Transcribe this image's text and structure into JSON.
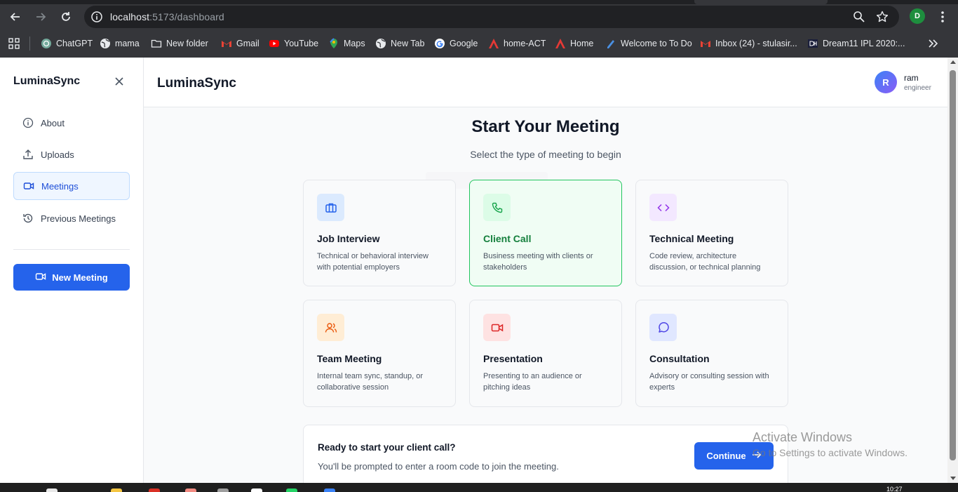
{
  "browser": {
    "url_host": "localhost",
    "url_path": ":5173/dashboard",
    "profile_initial": "D",
    "icons": [
      "back-icon",
      "forward-icon",
      "reload-icon",
      "info-icon",
      "zoom-icon",
      "star-icon",
      "kebab-menu-icon"
    ]
  },
  "bookmarks": [
    {
      "label": "ChatGPT",
      "icon": "chatgpt-icon"
    },
    {
      "label": "mama",
      "icon": "globe-icon"
    },
    {
      "label": "New folder",
      "icon": "folder-icon"
    },
    {
      "label": "Gmail",
      "icon": "gmail-icon"
    },
    {
      "label": "YouTube",
      "icon": "youtube-icon"
    },
    {
      "label": "Maps",
      "icon": "maps-icon"
    },
    {
      "label": "New Tab",
      "icon": "globe-icon"
    },
    {
      "label": "Google",
      "icon": "google-icon"
    },
    {
      "label": "home-ACT",
      "icon": "act-icon"
    },
    {
      "label": "Home",
      "icon": "act-icon"
    },
    {
      "label": "Welcome to To Do",
      "icon": "todo-icon"
    },
    {
      "label": "Inbox (24) - stulasir...",
      "icon": "gmail-icon"
    },
    {
      "label": "Dream11 IPL 2020:...",
      "icon": "dream11-icon"
    }
  ],
  "sidebar": {
    "brand": "LuminaSync",
    "items": [
      {
        "label": "About",
        "icon": "info-icon"
      },
      {
        "label": "Uploads",
        "icon": "upload-icon"
      },
      {
        "label": "Meetings",
        "icon": "video-icon",
        "active": true
      },
      {
        "label": "Previous Meetings",
        "icon": "history-icon"
      }
    ],
    "new_meeting_label": "New Meeting"
  },
  "header": {
    "title": "LuminaSync",
    "user": {
      "initial": "R",
      "name": "ram",
      "role": "engineer"
    }
  },
  "main": {
    "title": "Start Your Meeting",
    "subtitle": "Select the type of meeting to begin",
    "cards": [
      {
        "title": "Job Interview",
        "desc": "Technical or behavioral interview with potential employers",
        "icon": "briefcase-icon",
        "color": "#2563eb",
        "bg": "#dbeafe"
      },
      {
        "title": "Client Call",
        "desc": "Business meeting with clients or stakeholders",
        "icon": "phone-icon",
        "color": "#16a34a",
        "bg": "#dcfce7",
        "selected": true
      },
      {
        "title": "Technical Meeting",
        "desc": "Code review, architecture discussion, or technical planning",
        "icon": "code-icon",
        "color": "#9333ea",
        "bg": "#f3e8ff"
      },
      {
        "title": "Team Meeting",
        "desc": "Internal team sync, standup, or collaborative session",
        "icon": "users-icon",
        "color": "#ea580c",
        "bg": "#ffedd5"
      },
      {
        "title": "Presentation",
        "desc": "Presenting to an audience or pitching ideas",
        "icon": "video-icon",
        "color": "#dc2626",
        "bg": "#fee2e2"
      },
      {
        "title": "Consultation",
        "desc": "Advisory or consulting session with experts",
        "icon": "message-circle-icon",
        "color": "#4f46e5",
        "bg": "#e0e7ff"
      }
    ],
    "ready": {
      "title": "Ready to start your client call?",
      "desc": "You'll be prompted to enter a room code to join the meeting.",
      "button": "Continue"
    }
  },
  "watermark": {
    "line1": "Activate Windows",
    "line2": "Go to Settings to activate Windows."
  },
  "taskbar": {
    "time": "10:27"
  }
}
